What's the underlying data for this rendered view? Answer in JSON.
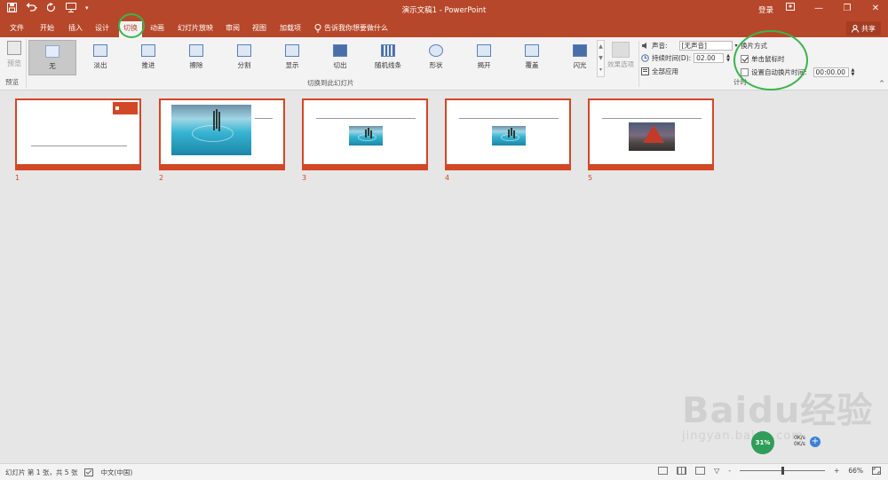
{
  "app": {
    "title": "演示文稿1 - PowerPoint",
    "login": "登录",
    "window_controls": [
      "minimize-icon",
      "restore-icon",
      "close-icon"
    ]
  },
  "tabs": {
    "items": [
      "文件",
      "开始",
      "插入",
      "设计",
      "切换",
      "动画",
      "幻灯片放映",
      "审阅",
      "视图",
      "加载项"
    ],
    "active": "切换",
    "tell_me": "告诉我你想要做什么",
    "share": "共享"
  },
  "ribbon": {
    "preview": {
      "label": "预览",
      "group": "预览"
    },
    "transitions": [
      {
        "label": "无",
        "icon": "none"
      },
      {
        "label": "淡出",
        "icon": "fade"
      },
      {
        "label": "推进",
        "icon": "push"
      },
      {
        "label": "擦除",
        "icon": "wipe"
      },
      {
        "label": "分割",
        "icon": "split"
      },
      {
        "label": "显示",
        "icon": "reveal"
      },
      {
        "label": "切出",
        "icon": "cut"
      },
      {
        "label": "随机线条",
        "icon": "random-bars"
      },
      {
        "label": "形状",
        "icon": "shape"
      },
      {
        "label": "揭开",
        "icon": "uncover"
      },
      {
        "label": "覆盖",
        "icon": "cover"
      },
      {
        "label": "闪光",
        "icon": "flash"
      }
    ],
    "gallery_group": "切换到此幻灯片",
    "effect_options": "效果选项",
    "timing": {
      "sound_label": "声音:",
      "sound_value": "[无声音]",
      "duration_label": "持续时间(D):",
      "duration_value": "02.00",
      "apply_all": "全部应用",
      "advance_label": "换片方式",
      "on_click": "单击鼠标时",
      "on_click_checked": true,
      "after_label": "设置自动换片时间:",
      "after_checked": false,
      "after_value": "00:00.00",
      "group": "计时"
    }
  },
  "slides": [
    {
      "number": "1",
      "content": "title-logo"
    },
    {
      "number": "2",
      "content": "pool-large"
    },
    {
      "number": "3",
      "content": "pool-small"
    },
    {
      "number": "4",
      "content": "pool-small"
    },
    {
      "number": "5",
      "content": "rock-small"
    }
  ],
  "statusbar": {
    "slide_info": "幻灯片 第 1 张，共 5 张",
    "language": "中文(中国)",
    "zoom": "66%",
    "zoom_minus": "-",
    "zoom_plus": "+"
  },
  "overlay": {
    "speed": "31%",
    "net_up": "0K/s",
    "net_down": "0K/s",
    "watermark_main": "Baidu经验",
    "watermark_sub": "jingyan.baidu.com"
  },
  "colors": {
    "accent": "#b7472a",
    "slide_border": "#d24726",
    "annotation": "#39b54a"
  }
}
